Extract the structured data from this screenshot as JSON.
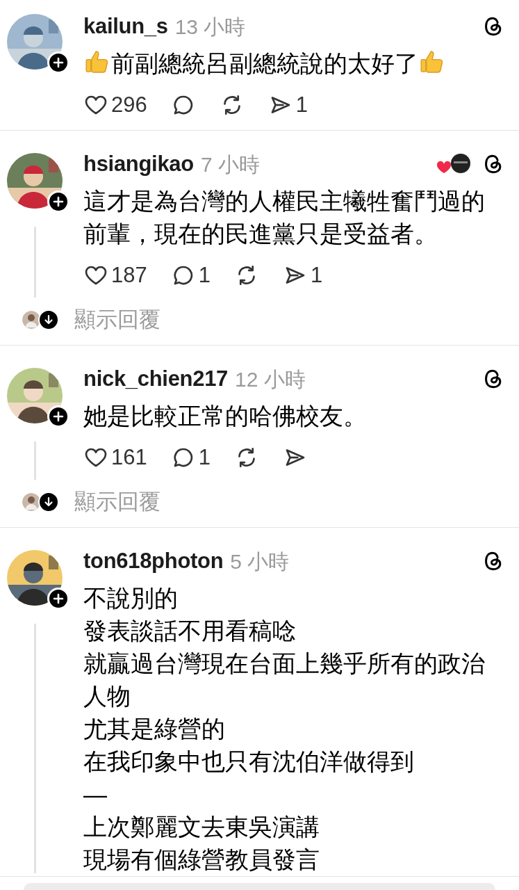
{
  "posts": [
    {
      "username": "kailun_s",
      "time": "13 小時",
      "paragraphs": [
        "前副總統呂副總統說的太好了"
      ],
      "thumbs_up_start": true,
      "thumbs_up_end": true,
      "likes": "296",
      "shares": "1"
    },
    {
      "username": "hsiangikao",
      "time": "7 小時",
      "author_liked": true,
      "thread_line": true,
      "paragraphs": [
        "這才是為台灣的人權民主犧牲奮鬥過的前輩，現在的民進黨只是受益者。"
      ],
      "likes": "187",
      "replies": "1",
      "shares": "1",
      "show_replies": "顯示回覆"
    },
    {
      "username": "nick_chien217",
      "time": "12 小時",
      "thread_line": true,
      "paragraphs": [
        "她是比較正常的哈佛校友。"
      ],
      "likes": "161",
      "replies": "1",
      "show_replies": "顯示回覆"
    },
    {
      "username": "ton618photon",
      "time": "5 小時",
      "thread_line": true,
      "paragraphs": [
        "不說別的",
        "發表談話不用看稿唸",
        "就贏過台灣現在台面上幾乎所有的政治人物",
        "尤其是綠營的",
        "在我印象中也只有沈伯洋做得到",
        "—",
        "上次鄭麗文去東吳演講",
        "現場有個綠營教員發言"
      ]
    }
  ]
}
